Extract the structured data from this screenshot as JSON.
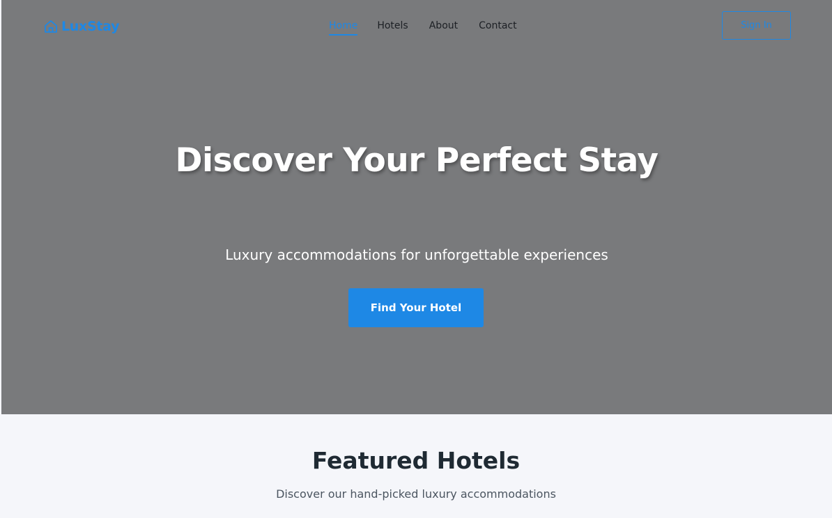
{
  "brand": {
    "name": "LuxStay",
    "icon": "house-icon",
    "color": "#1e88e5"
  },
  "nav": {
    "items": [
      {
        "label": "Home",
        "active": true
      },
      {
        "label": "Hotels",
        "active": false
      },
      {
        "label": "About",
        "active": false
      },
      {
        "label": "Contact",
        "active": false
      }
    ],
    "signin_label": "Sign In"
  },
  "hero": {
    "title": "Discover Your Perfect Stay",
    "subtitle": "Luxury accommodations for unforgettable experiences",
    "cta_label": "Find Your Hotel",
    "background": "#797a7c"
  },
  "featured": {
    "title": "Featured Hotels",
    "subtitle": "Discover our hand-picked luxury accommodations"
  }
}
